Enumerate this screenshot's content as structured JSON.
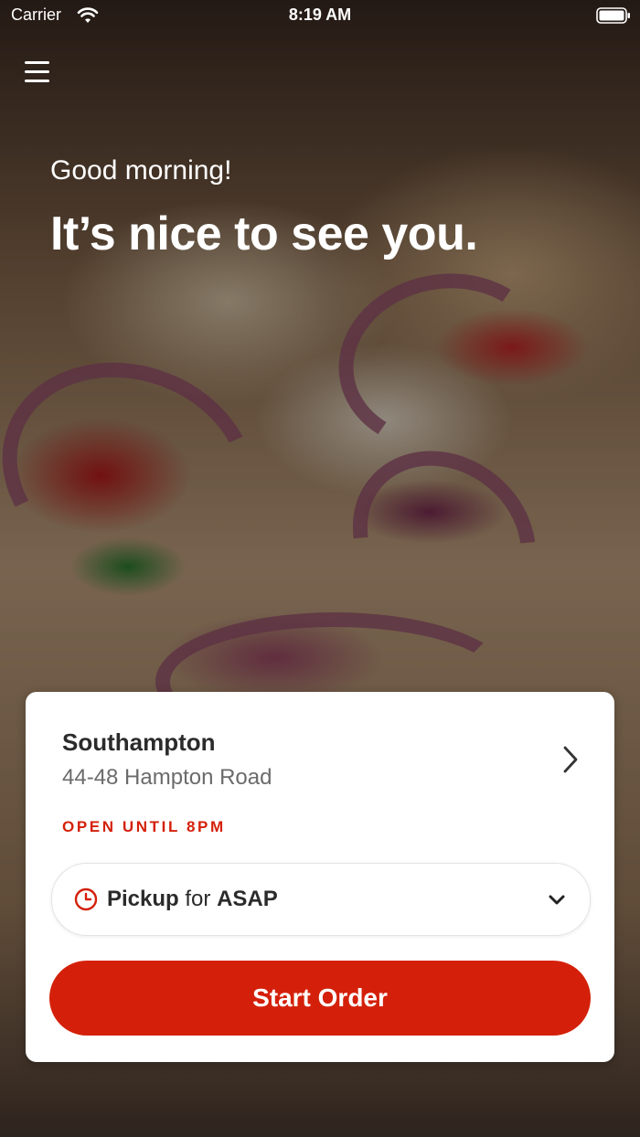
{
  "status_bar": {
    "carrier": "Carrier",
    "time": "8:19 AM",
    "icons": [
      "wifi-icon",
      "battery-icon"
    ]
  },
  "header": {
    "menu_icon": "hamburger-menu-icon",
    "greeting": "Good morning!",
    "headline": "It’s nice to see you."
  },
  "store": {
    "name": "Southampton",
    "address": "44-48 Hampton Road",
    "status": "OPEN UNTIL 8PM"
  },
  "order_mode": {
    "type": "Pickup",
    "connector": "for",
    "time": "ASAP",
    "icon": "clock-icon"
  },
  "actions": {
    "start_order_label": "Start Order"
  },
  "colors": {
    "accent": "#d4200a",
    "text_primary": "#2b2b2b",
    "text_secondary": "#6b6b6b",
    "card_background": "#ffffff"
  }
}
